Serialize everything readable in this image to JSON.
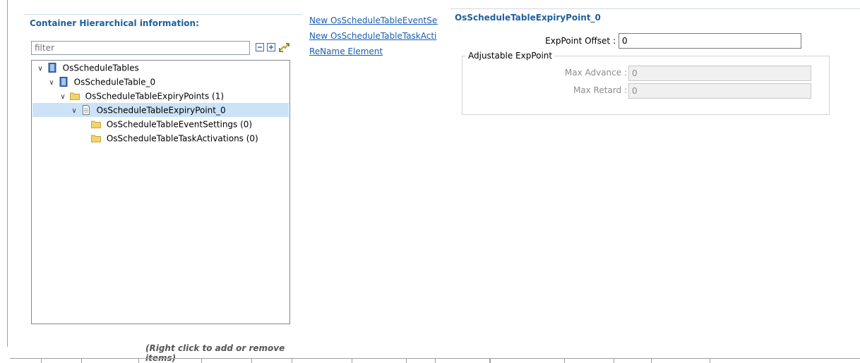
{
  "left_panel": {
    "title": "Container Hierarchical information:",
    "filter_placeholder": "filter",
    "tree": [
      {
        "label": "OsScheduleTables",
        "icon": "table-icon",
        "expanded": true,
        "level": 0
      },
      {
        "label": "OsScheduleTable_0",
        "icon": "table-icon",
        "expanded": true,
        "level": 1
      },
      {
        "label": "OsScheduleTableExpiryPoints (1)",
        "icon": "folder-icon",
        "expanded": true,
        "level": 2
      },
      {
        "label": "OsScheduleTableExpiryPoint_0",
        "icon": "document-icon",
        "expanded": true,
        "level": 3,
        "selected": true
      },
      {
        "label": "OsScheduleTableEventSettings (0)",
        "icon": "folder-icon",
        "level": 4
      },
      {
        "label": "OsScheduleTableTaskActivations (0)",
        "icon": "folder-icon",
        "level": 4
      }
    ],
    "hint": "(Right click to add or remove items)"
  },
  "links": {
    "new_event": "New OsScheduleTableEventSet",
    "new_task": "New OsScheduleTableTaskActi",
    "rename": "ReName Element"
  },
  "right_panel": {
    "title": "OsScheduleTableExpiryPoint_0",
    "exp_offset_label": "ExpPoint Offset :",
    "exp_offset_value": "0",
    "group_title": "Adjustable ExpPoint",
    "max_advance_label": "Max Advance :",
    "max_advance_value": "0",
    "max_retard_label": "Max Retard :",
    "max_retard_value": "0"
  },
  "colors": {
    "title_blue": "#1f5f9e",
    "link_blue": "#1a5eb1",
    "selection": "#cce3f7"
  }
}
